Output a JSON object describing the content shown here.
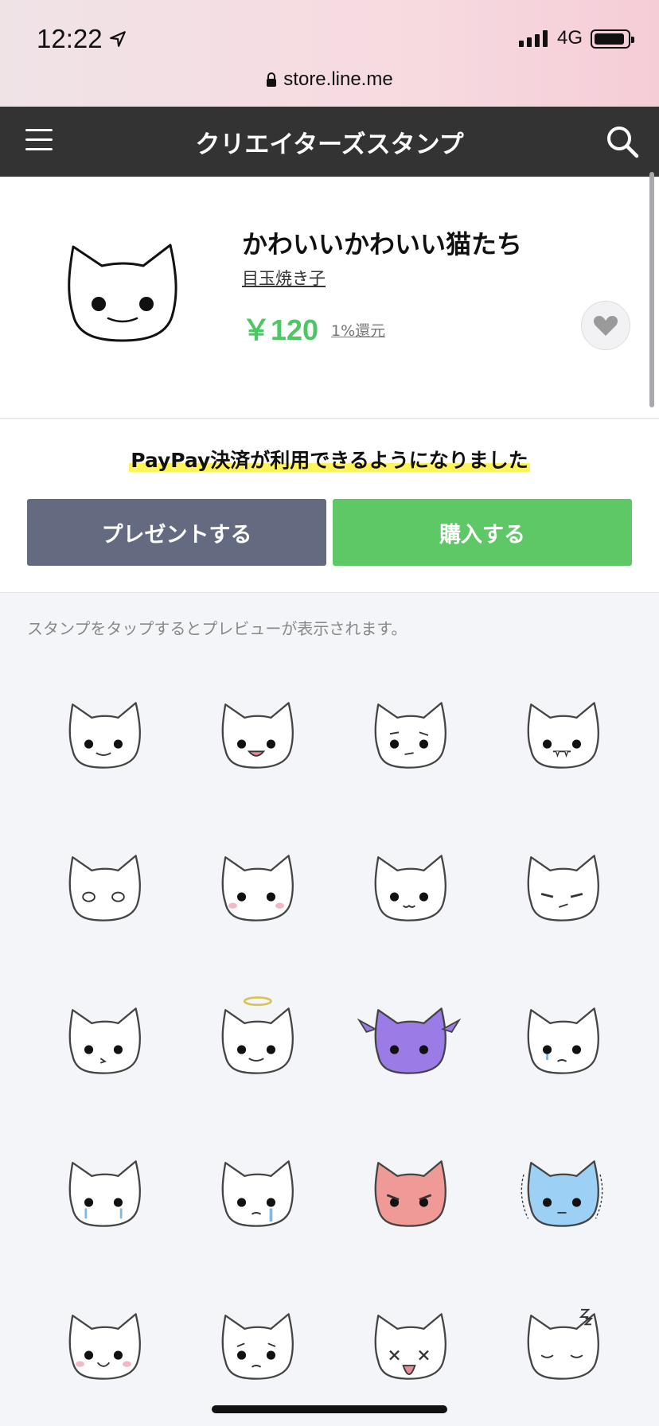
{
  "status_bar": {
    "time": "12:22",
    "network": "4G"
  },
  "browser": {
    "url": "store.line.me"
  },
  "header": {
    "title": "クリエイターズスタンプ"
  },
  "product": {
    "title": "かわいいかわいい猫たち",
    "author": "目玉焼き子",
    "price": "￥120",
    "reward": "1%還元"
  },
  "purchase": {
    "paypay_notice": "PayPay決済が利用できるようになりました",
    "present_label": "プレゼントする",
    "buy_label": "購入する"
  },
  "preview_hint": "スタンプをタップするとプレビューが表示されます。",
  "stickers": [
    {
      "name": "cat-smile",
      "color": "#ffffff"
    },
    {
      "name": "cat-grin",
      "color": "#ffffff"
    },
    {
      "name": "cat-puzzled",
      "color": "#ffffff"
    },
    {
      "name": "cat-fang",
      "color": "#ffffff"
    },
    {
      "name": "cat-wide-eyes",
      "color": "#ffffff"
    },
    {
      "name": "cat-blush",
      "color": "#ffffff"
    },
    {
      "name": "cat-happy-mouth",
      "color": "#ffffff"
    },
    {
      "name": "cat-smug",
      "color": "#ffffff"
    },
    {
      "name": "cat-pout",
      "color": "#ffffff"
    },
    {
      "name": "cat-angel",
      "color": "#ffffff"
    },
    {
      "name": "cat-devil",
      "color": "#9b7ce6"
    },
    {
      "name": "cat-sad",
      "color": "#ffffff"
    },
    {
      "name": "cat-teary",
      "color": "#ffffff"
    },
    {
      "name": "cat-crying",
      "color": "#ffffff"
    },
    {
      "name": "cat-angry",
      "color": "#ef9a97"
    },
    {
      "name": "cat-shocked",
      "color": "#9cd0f5"
    },
    {
      "name": "cat-cheerful",
      "color": "#ffffff"
    },
    {
      "name": "cat-worried",
      "color": "#ffffff"
    },
    {
      "name": "cat-dizzy",
      "color": "#ffffff"
    },
    {
      "name": "cat-sleeping",
      "color": "#ffffff"
    }
  ],
  "colors": {
    "navbar": "#333333",
    "price": "#4cc764",
    "present_button": "#646b81",
    "buy_button": "#5ec866",
    "highlight": "#fff35a"
  }
}
